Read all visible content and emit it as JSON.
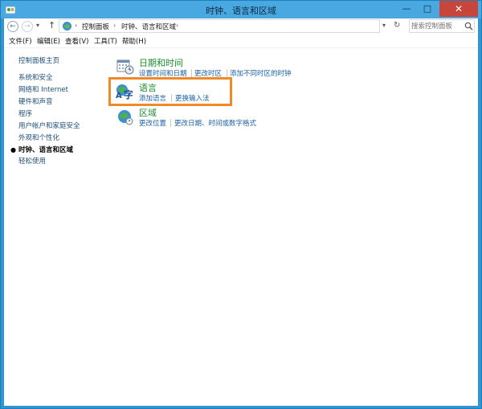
{
  "window": {
    "title": "时钟、语言和区域",
    "minimize": "—",
    "maximize": "□",
    "close": "✕"
  },
  "address": {
    "nav_back": "←",
    "nav_forward": "→",
    "nav_dropdown": "▾",
    "nav_up": "↑",
    "separator": "›",
    "crumbs": [
      "控制面板",
      "时钟、语言和区域"
    ],
    "dropdown": "▾",
    "refresh": "↻",
    "search_placeholder": "搜索控制面板"
  },
  "menu": {
    "items": [
      "文件(F)",
      "编辑(E)",
      "查看(V)",
      "工具(T)",
      "帮助(H)"
    ]
  },
  "sidebar": {
    "home": "控制面板主页",
    "bullet": "●",
    "items": [
      "系统和安全",
      "网络和 Internet",
      "硬件和声音",
      "程序",
      "用户帐户和家庭安全",
      "外观和个性化",
      "时钟、语言和区域",
      "轻松使用"
    ],
    "current_index": 6
  },
  "categories": [
    {
      "title": "日期和时间",
      "icon": "calendar-clock-icon",
      "links": [
        "设置时间和日期",
        "更改时区",
        "添加不同时区的时钟"
      ]
    },
    {
      "title": "语言",
      "icon": "language-icon",
      "links": [
        "添加语言",
        "更换输入法"
      ]
    },
    {
      "title": "区域",
      "icon": "globe-clock-icon",
      "links": [
        "更改位置",
        "更改日期、时间或数字格式"
      ]
    }
  ],
  "colors": {
    "highlight": "#ee8a2a",
    "category_title": "#1c8e2d",
    "link": "#1a62a8",
    "window_frame": "#2e96d3"
  }
}
